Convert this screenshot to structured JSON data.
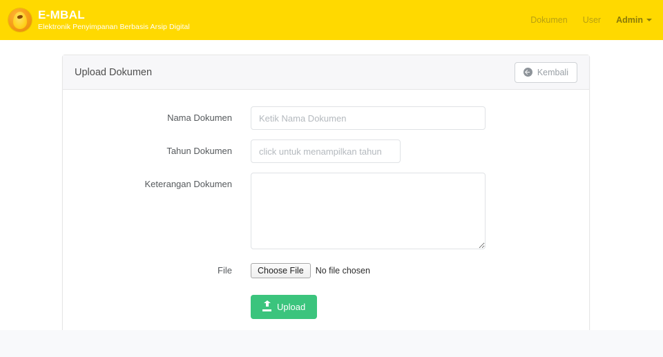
{
  "navbar": {
    "brand": {
      "logo_icon": "egg-archive-logo-icon",
      "title": "E-MBAL",
      "subtitle": "Elektronik Penyimpanan Berbasis Arsip Digital"
    },
    "links": [
      {
        "label": "Dokumen",
        "active": false
      },
      {
        "label": "User",
        "active": false
      },
      {
        "label": "Admin",
        "active": true,
        "icon": "chevron-down-icon"
      }
    ],
    "background_color": "#ffd900"
  },
  "card": {
    "title": "Upload Dokumen",
    "back_button": {
      "label": "Kembali",
      "icon": "arrow-left-circle-icon"
    },
    "form": {
      "fields": [
        {
          "label": "Nama Dokumen",
          "name": "nama-dokumen",
          "type": "text",
          "value": "",
          "placeholder": "Ketik Nama Dokumen"
        },
        {
          "label": "Tahun Dokumen",
          "name": "tahun-dokumen",
          "type": "text",
          "value": "",
          "placeholder": "click untuk menampilkan tahun"
        },
        {
          "label": "Keterangan Dokumen",
          "name": "keterangan-dokumen",
          "type": "textarea",
          "value": "",
          "placeholder": ""
        }
      ],
      "file_row": {
        "label": "File",
        "button_label": "Choose File",
        "status_text": "No file chosen"
      },
      "submit": {
        "label": "Upload",
        "icon": "upload-icon",
        "color": "#3bc47d"
      }
    }
  }
}
